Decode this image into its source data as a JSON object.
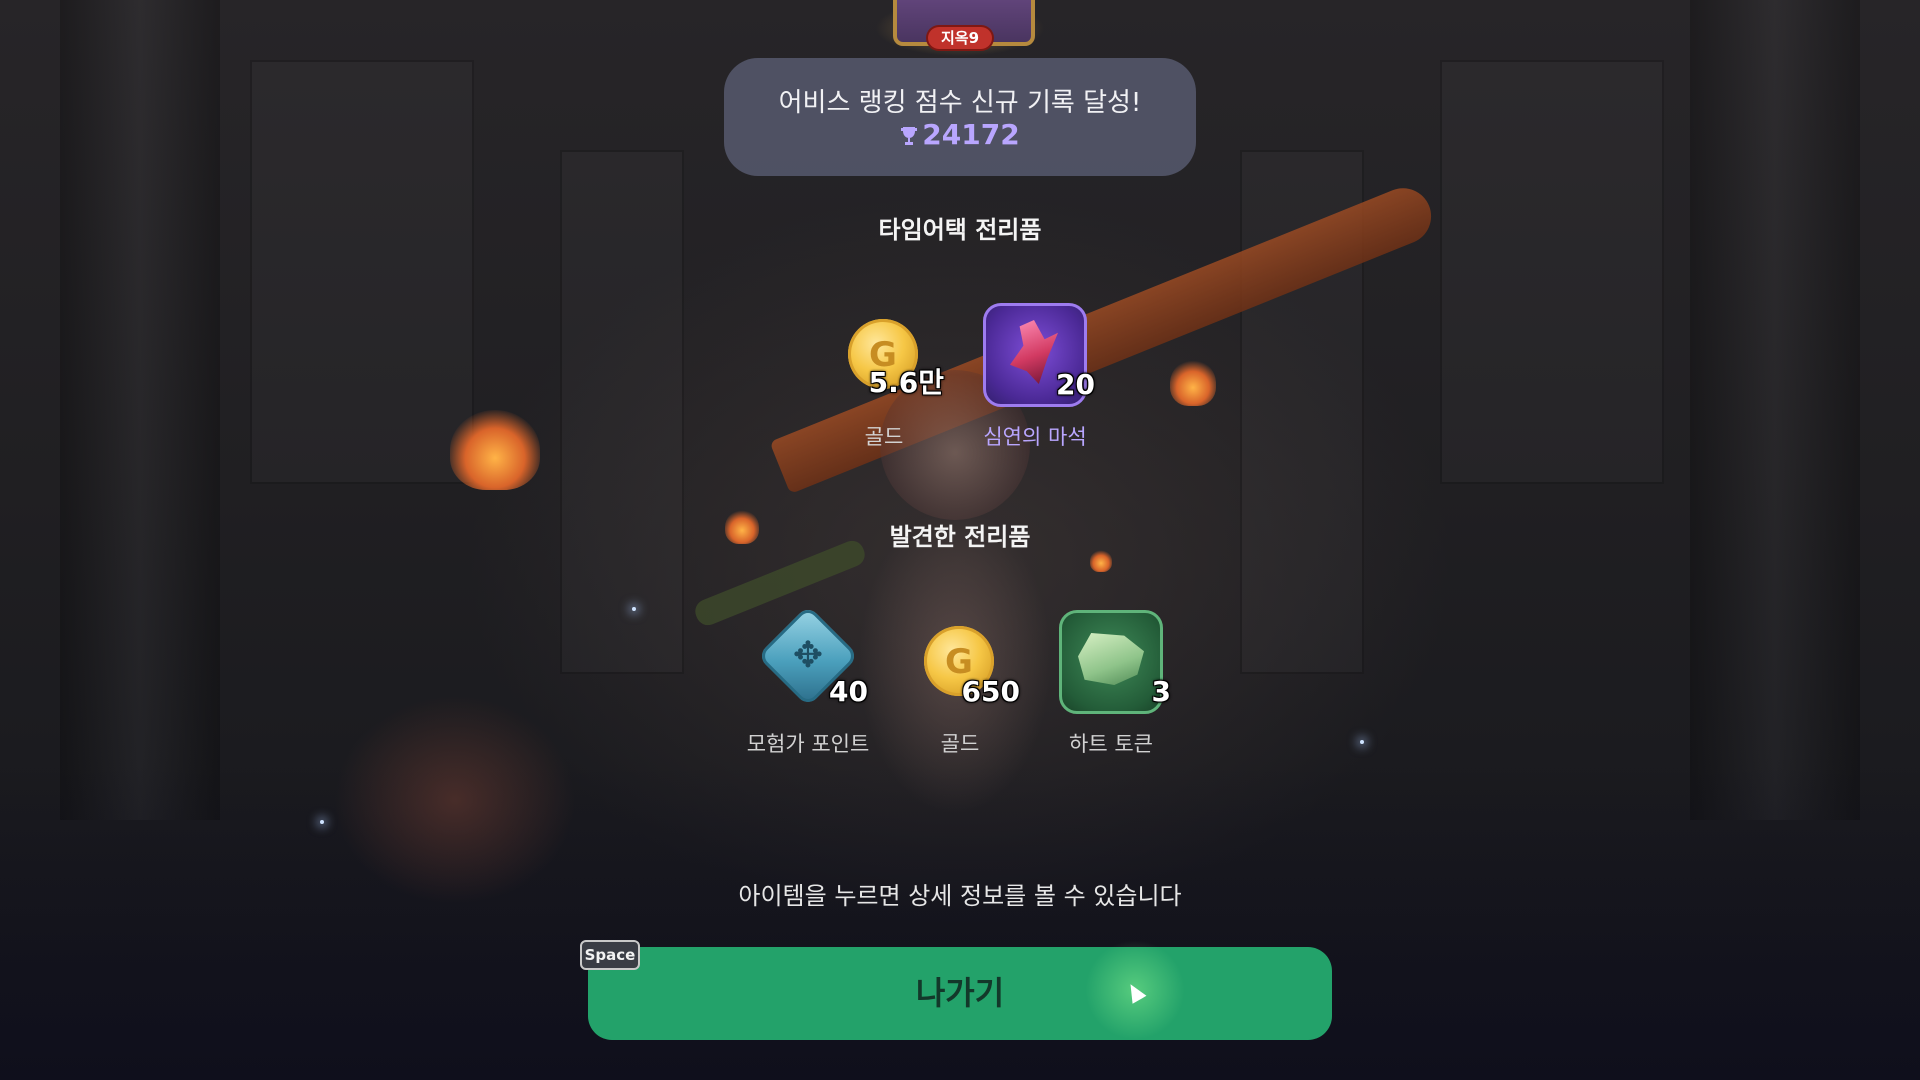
{
  "header": {
    "floor_tag": "지옥9"
  },
  "record": {
    "title": "어비스 랭킹 점수 신규 기록 달성!",
    "score": "24172",
    "score_color": "#b9a6ff"
  },
  "time_attack_loot": {
    "title": "타임어택 전리품",
    "items": [
      {
        "icon": "gold-coin-icon",
        "quantity": "5.6만",
        "label": "골드"
      },
      {
        "icon": "abyss-crystal-icon",
        "quantity": "20",
        "label": "심연의 마석"
      }
    ]
  },
  "found_loot": {
    "title": "발견한 전리품",
    "items": [
      {
        "icon": "adventurer-point-icon",
        "quantity": "40",
        "label": "모험가 포인트"
      },
      {
        "icon": "gold-coin-icon",
        "quantity": "650",
        "label": "골드"
      },
      {
        "icon": "heart-token-icon",
        "quantity": "3",
        "label": "하트 토큰"
      }
    ]
  },
  "hint": "아이템을 누르면 상세 정보를 볼 수 있습니다",
  "exit_button": {
    "label": "나가기",
    "shortcut": "Space",
    "color": "#23a26a"
  }
}
